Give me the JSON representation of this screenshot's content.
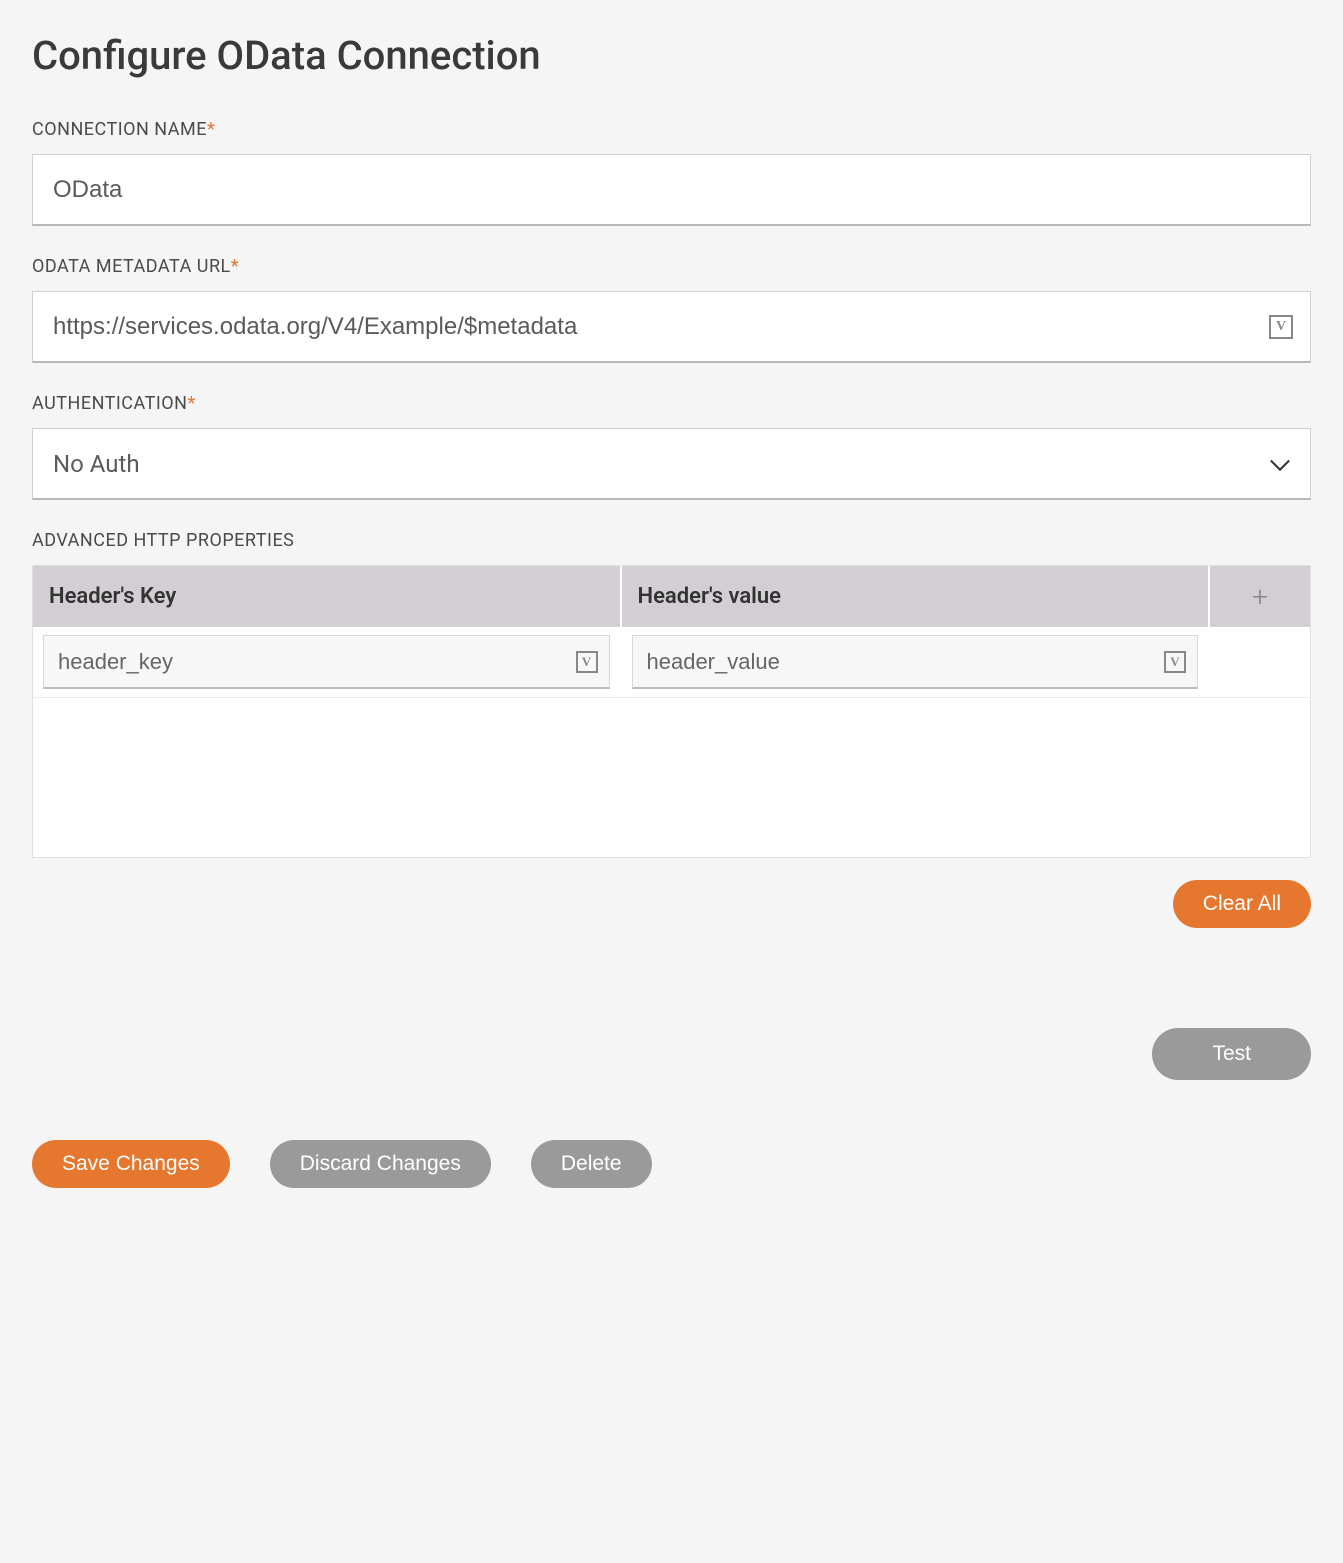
{
  "title": "Configure OData Connection",
  "fields": {
    "connection_name": {
      "label": "CONNECTION NAME",
      "required": "*",
      "value": "OData"
    },
    "metadata_url": {
      "label": "ODATA METADATA URL",
      "required": "*",
      "value": "https://services.odata.org/V4/Example/$metadata"
    },
    "authentication": {
      "label": "AUTHENTICATION",
      "required": "*",
      "value": "No Auth"
    },
    "advanced": {
      "label": "ADVANCED HTTP PROPERTIES",
      "columns": {
        "key": "Header's Key",
        "value": "Header's value"
      },
      "rows": [
        {
          "key": "header_key",
          "value": "header_value"
        }
      ]
    }
  },
  "buttons": {
    "clear_all": "Clear All",
    "test": "Test",
    "save": "Save Changes",
    "discard": "Discard Changes",
    "delete": "Delete"
  },
  "icons": {
    "v_badge": "V",
    "plus": "+"
  }
}
